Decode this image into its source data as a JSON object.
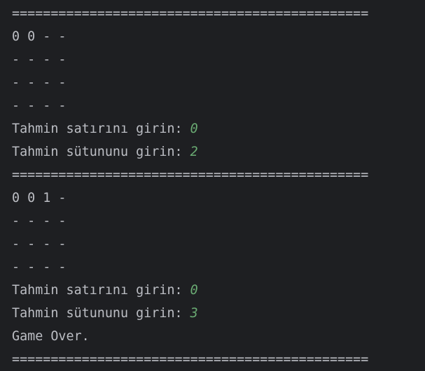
{
  "console": {
    "lines": [
      {
        "text": "=============================================="
      },
      {
        "text": "0 0 - -"
      },
      {
        "text": "- - - -"
      },
      {
        "text": "- - - -"
      },
      {
        "text": "- - - -"
      },
      {
        "text": "Tahmin satırını girin: ",
        "input": "0"
      },
      {
        "text": "Tahmin sütununu girin: ",
        "input": "2"
      },
      {
        "text": "=============================================="
      },
      {
        "text": "0 0 1 -"
      },
      {
        "text": "- - - -"
      },
      {
        "text": "- - - -"
      },
      {
        "text": "- - - -"
      },
      {
        "text": "Tahmin satırını girin: ",
        "input": "0"
      },
      {
        "text": "Tahmin sütununu girin: ",
        "input": "3"
      },
      {
        "text": "Game Over."
      },
      {
        "text": "=============================================="
      }
    ],
    "colors": {
      "background": "#1e1f22",
      "text": "#bcbec4",
      "user_input": "#6aab73"
    }
  }
}
